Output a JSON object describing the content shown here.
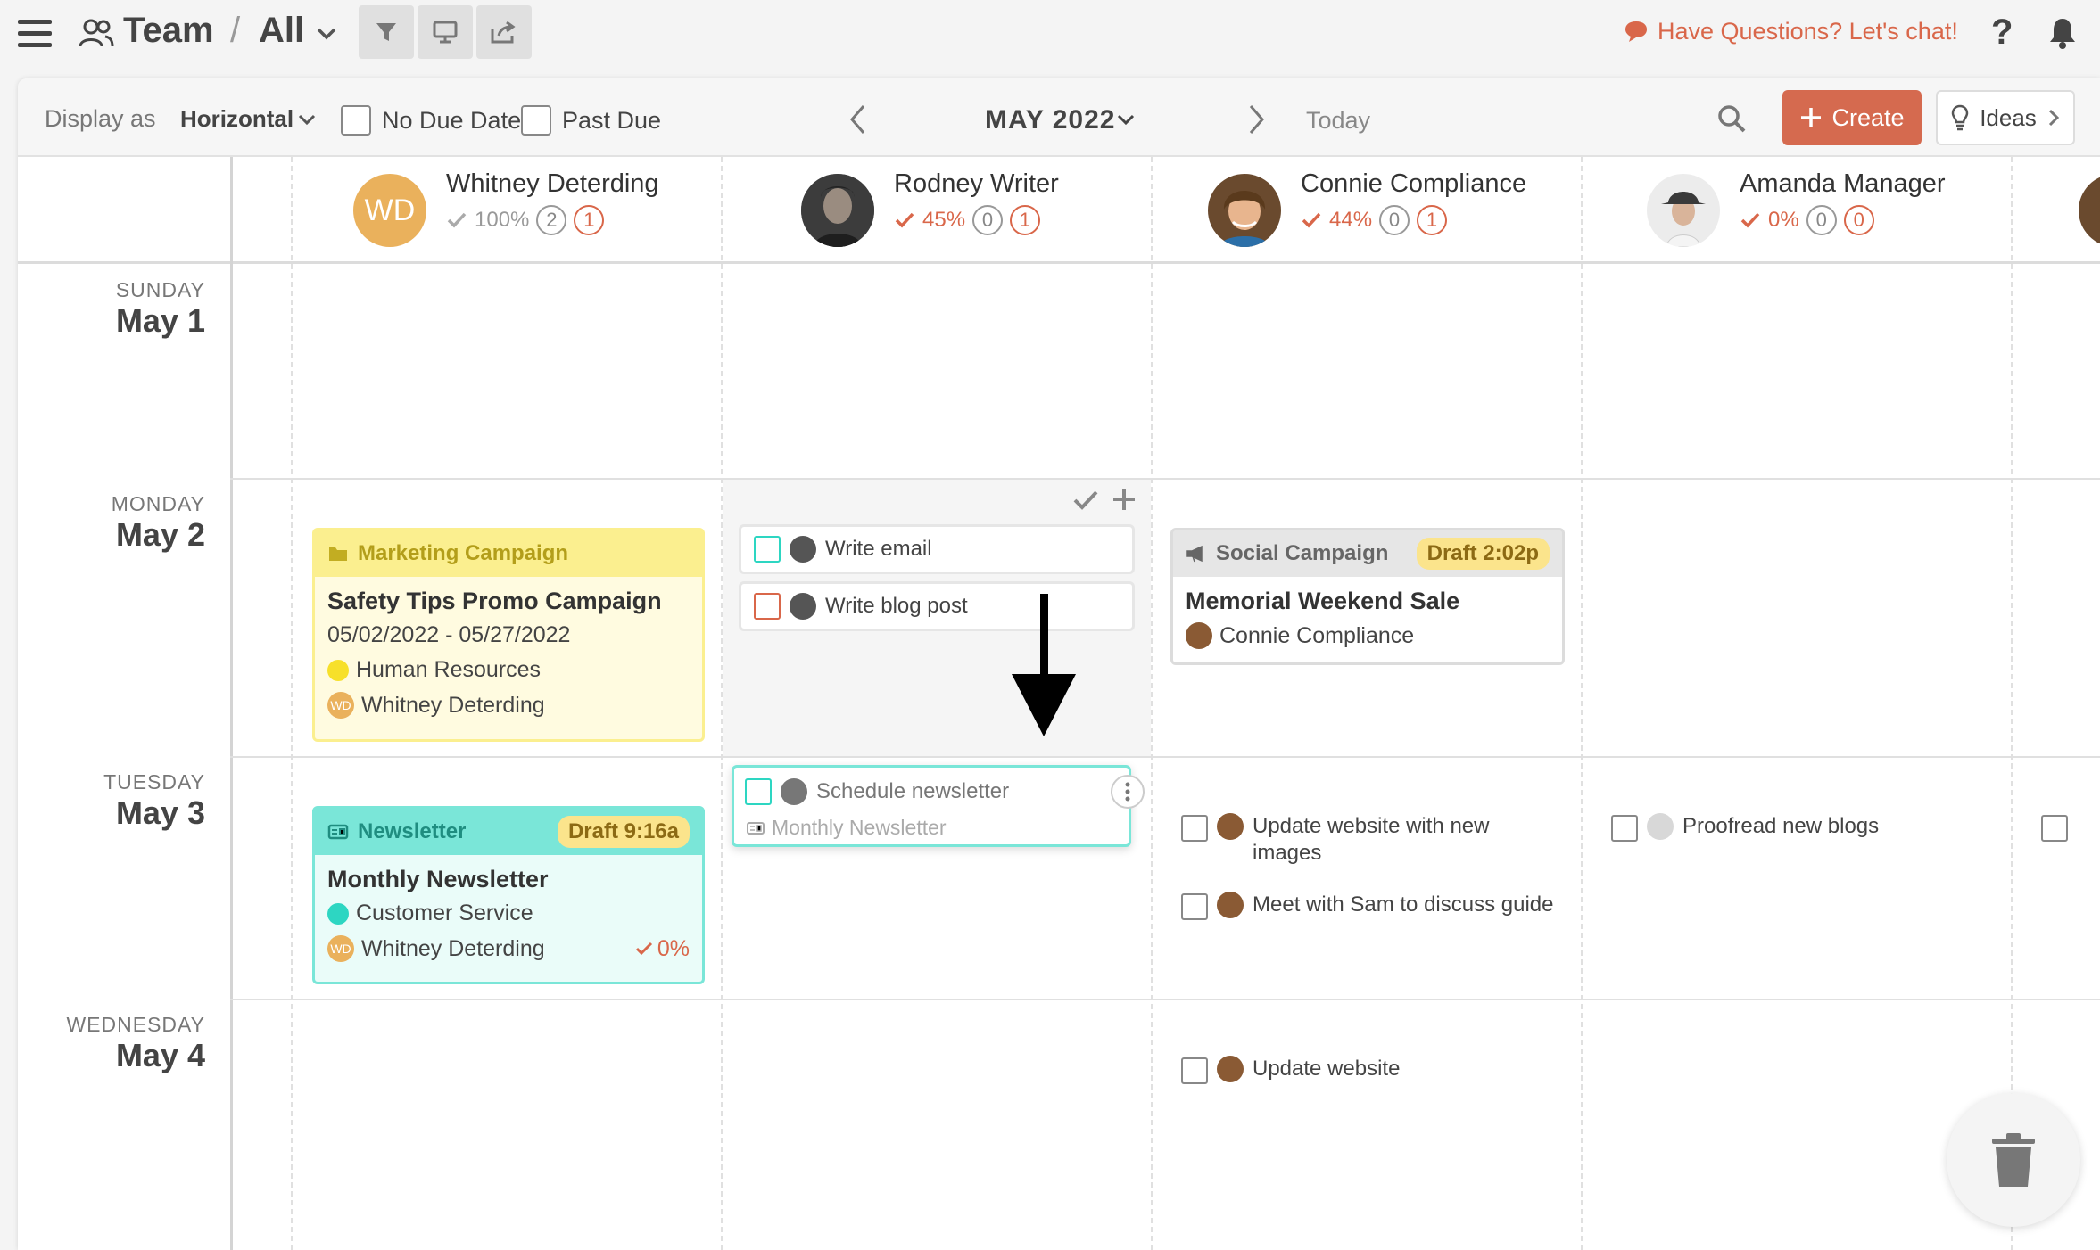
{
  "topbar": {
    "team_label": "Team",
    "separator": "/",
    "view_label": "All",
    "chat_label": "Have Questions? Let's chat!",
    "help_label": "?"
  },
  "toolbar": {
    "display_as_label": "Display as",
    "display_mode": "Horizontal",
    "no_due_date_label": "No Due Date",
    "past_due_label": "Past Due",
    "month_label": "MAY 2022",
    "today_label": "Today",
    "create_label": "Create",
    "ideas_label": "Ideas"
  },
  "people": [
    {
      "name": "Whitney Deterding",
      "initials": "WD",
      "percent": "100%",
      "count_a": "2",
      "count_b": "1"
    },
    {
      "name": "Rodney Writer",
      "percent": "45%",
      "count_a": "0",
      "count_b": "1"
    },
    {
      "name": "Connie Compliance",
      "percent": "44%",
      "count_a": "0",
      "count_b": "1"
    },
    {
      "name": "Amanda Manager",
      "percent": "0%",
      "count_a": "0",
      "count_b": "0"
    }
  ],
  "days": [
    {
      "weekday": "SUNDAY",
      "date": "May 1"
    },
    {
      "weekday": "MONDAY",
      "date": "May 2"
    },
    {
      "weekday": "TUESDAY",
      "date": "May 3"
    },
    {
      "weekday": "WEDNESDAY",
      "date": "May 4"
    }
  ],
  "cards": {
    "marketing": {
      "type_label": "Marketing Campaign",
      "title": "Safety Tips Promo Campaign",
      "dates": "05/02/2022 - 05/27/2022",
      "team": "Human Resources",
      "owner_initials": "WD",
      "owner": "Whitney Deterding"
    },
    "social": {
      "type_label": "Social Campaign",
      "badge": "Draft 2:02p",
      "title": "Memorial Weekend Sale",
      "owner": "Connie Compliance"
    },
    "newsletter": {
      "type_label": "Newsletter",
      "badge": "Draft 9:16a",
      "title": "Monthly Newsletter",
      "team": "Customer Service",
      "owner_initials": "WD",
      "owner": "Whitney Deterding",
      "percent": "0%"
    }
  },
  "tasks": {
    "write_email": "Write email",
    "write_blog": "Write blog post",
    "schedule_newsletter": "Schedule newsletter",
    "schedule_newsletter_parent": "Monthly Newsletter",
    "update_images": "Update website with new images",
    "meet_sam": "Meet with Sam to discuss guide",
    "proofread": "Proofread new blogs",
    "update_website": "Update website"
  },
  "colors": {
    "accent": "#d56a4f",
    "marketing_yellow": "#fbef8f",
    "newsletter_teal": "#7ae6d8",
    "teal_dot": "#2dd6c2",
    "yellow_dot": "#f7e02a",
    "draft_badge": "#fbe48c"
  }
}
